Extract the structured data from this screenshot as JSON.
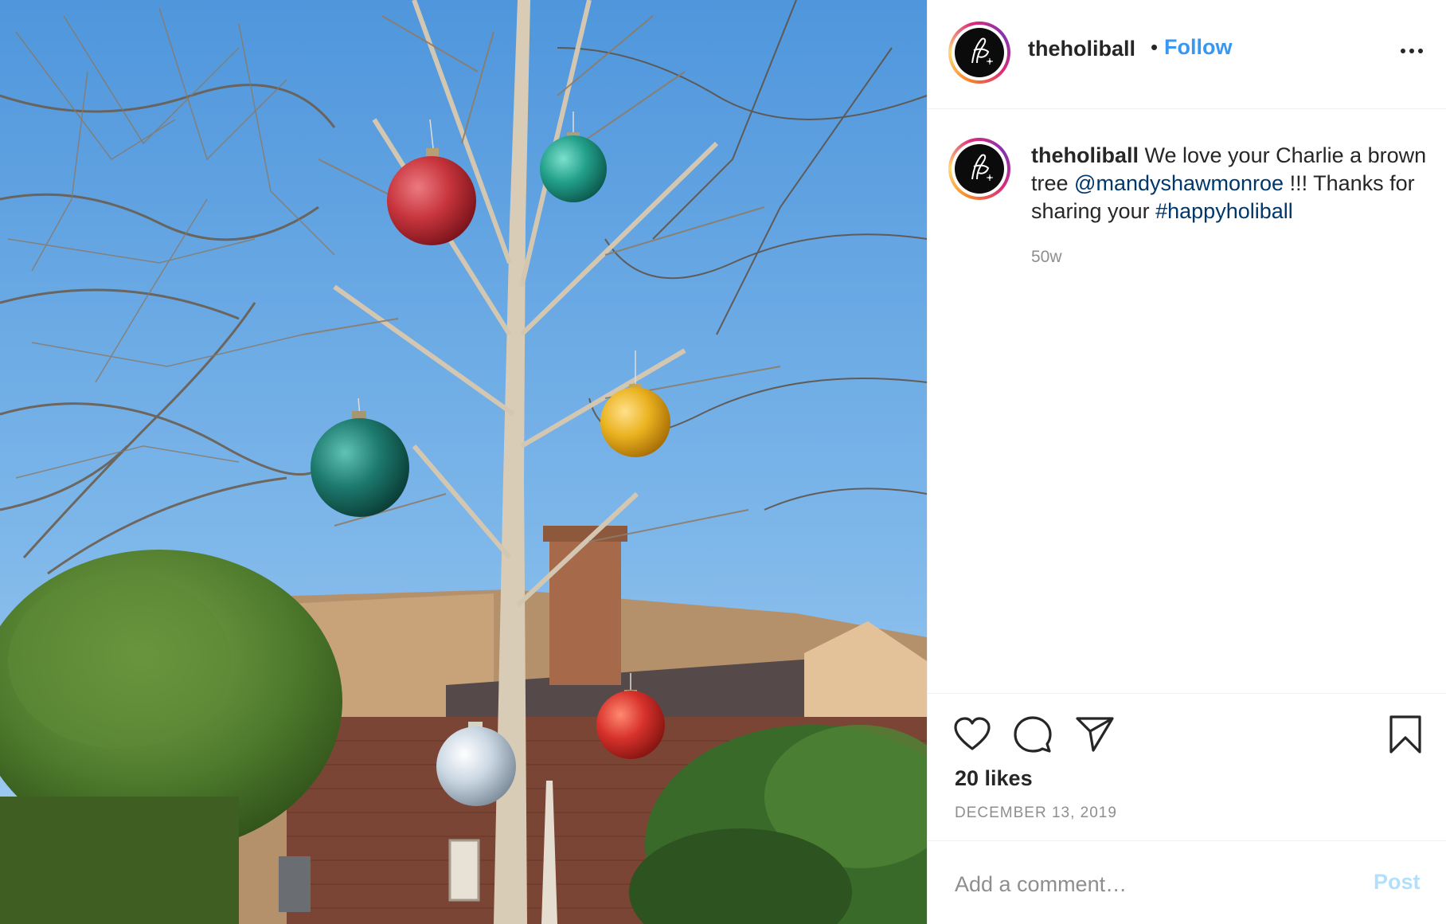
{
  "post": {
    "image_alt": "Bare tree decorated with giant colorful ornament balls in front of a brick house",
    "ornaments": [
      {
        "name": "red",
        "color": "#c8353d"
      },
      {
        "name": "teal",
        "color": "#23a08a"
      },
      {
        "name": "gold",
        "color": "#eab21f"
      },
      {
        "name": "dark-teal",
        "color": "#1d7a6e"
      },
      {
        "name": "red-lower",
        "color": "#d8322c"
      },
      {
        "name": "silver",
        "color": "#c9d6e2"
      }
    ]
  },
  "header": {
    "username": "theholiball",
    "separator": "•",
    "follow_label": "Follow"
  },
  "caption": {
    "username": "theholiball",
    "text_part1": "We love your Charlie a brown tree",
    "mention": "@mandyshawmonroe",
    "text_part2": "!!! Thanks for sharing your",
    "hashtag": "#happyholiball",
    "age": "50w"
  },
  "actions": {
    "like_icon": "heart-icon",
    "comment_icon": "speech-bubble-icon",
    "share_icon": "paper-plane-icon",
    "save_icon": "bookmark-icon",
    "likes": "20 likes",
    "date": "DECEMBER 13, 2019"
  },
  "comment_box": {
    "placeholder": "Add a comment…",
    "post_label": "Post"
  },
  "colors": {
    "accent": "#3897f0",
    "link": "#00376b",
    "muted": "#8e8e8e",
    "post_disabled": "#b2dffc"
  }
}
